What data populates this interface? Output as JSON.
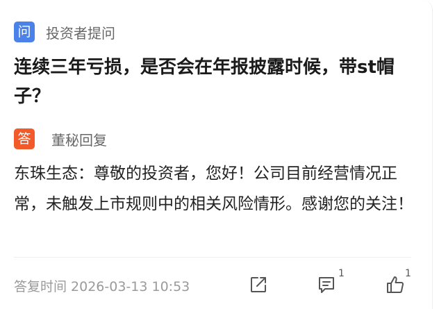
{
  "question": {
    "badge": "问",
    "label": "投资者提问",
    "text": "连续三年亏损，是否会在年报披露时候，带st帽子？"
  },
  "answer": {
    "badge": "答",
    "label": "董秘回复",
    "text": "东珠生态：尊敬的投资者，您好！公司目前经营情况正常，未触发上市规则中的相关风险情形。感谢您的关注！"
  },
  "footer": {
    "reply_time": "答复时间 2026-03-13 10:53",
    "comment_count": "1",
    "like_count": "1"
  },
  "icons": {
    "share": "share-icon",
    "comment": "comment-icon",
    "like": "thumbs-up-icon"
  },
  "colors": {
    "question_badge": "#4a82ea",
    "answer_badge": "#f25a2a"
  }
}
